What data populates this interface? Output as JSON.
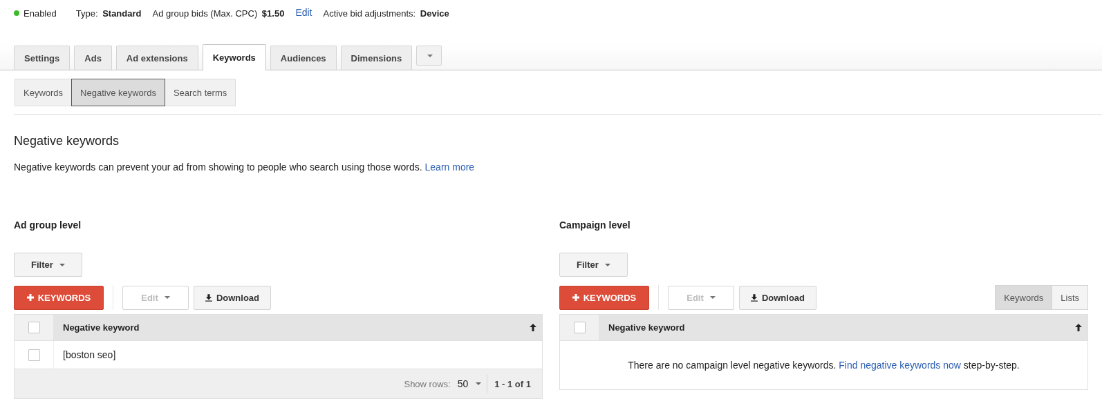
{
  "status": {
    "label": "Enabled",
    "enabled": true
  },
  "summary": [
    {
      "kind": "field",
      "label": "Type:",
      "value": "Standard"
    },
    {
      "kind": "field",
      "label": "Ad group bids (Max. CPC)",
      "value": "$1.50"
    },
    {
      "kind": "link",
      "label": "Edit"
    },
    {
      "kind": "field",
      "label": "Active bid adjustments:",
      "value": "Device"
    }
  ],
  "tabs": [
    {
      "label": "Settings",
      "selected": false
    },
    {
      "label": "Ads",
      "selected": false
    },
    {
      "label": "Ad extensions",
      "selected": false
    },
    {
      "label": "Keywords",
      "selected": true
    },
    {
      "label": "Audiences",
      "selected": false
    },
    {
      "label": "Dimensions",
      "selected": false
    }
  ],
  "subtabs": [
    {
      "label": "Keywords",
      "selected": false
    },
    {
      "label": "Negative keywords",
      "selected": true
    },
    {
      "label": "Search terms",
      "selected": false
    }
  ],
  "heading": "Negative keywords",
  "description": {
    "text": "Negative keywords can prevent your ad from showing to people who search using those words.",
    "link": "Learn more"
  },
  "panels": [
    {
      "title": "Ad group level",
      "filter": "Filter",
      "add_button": "KEYWORDS",
      "edit_button": {
        "label": "Edit",
        "disabled": true
      },
      "download_button": "Download",
      "table": {
        "column": "Negative keyword",
        "select_all_checked": false,
        "rows": [
          {
            "keyword": "[boston seo]",
            "checked": false
          }
        ],
        "footer": {
          "show_rows_label": "Show rows:",
          "show_rows_value": "50",
          "range": "1 - 1 of 1"
        }
      }
    },
    {
      "title": "Campaign level",
      "filter": "Filter",
      "add_button": "KEYWORDS",
      "edit_button": {
        "label": "Edit",
        "disabled": true
      },
      "download_button": "Download",
      "view_toggle": [
        {
          "label": "Keywords",
          "selected": true
        },
        {
          "label": "Lists",
          "selected": false
        }
      ],
      "table": {
        "column": "Negative keyword",
        "select_all_checked": false,
        "empty_message": {
          "text": "There are no campaign level negative keywords.",
          "link": "Find negative keywords now",
          "suffix": "step-by-step."
        }
      }
    }
  ]
}
